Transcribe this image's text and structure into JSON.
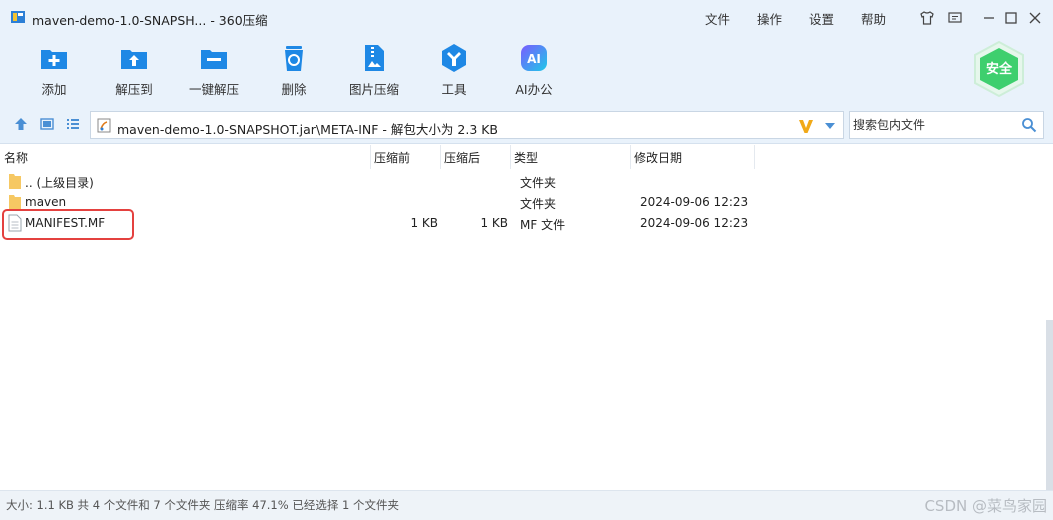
{
  "window": {
    "title": "maven-demo-1.0-SNAPSH... - 360压缩",
    "menus": [
      "文件",
      "操作",
      "设置",
      "帮助"
    ]
  },
  "toolbar": {
    "tools": [
      {
        "label": "添加",
        "icon": "add-icon"
      },
      {
        "label": "解压到",
        "icon": "extract-to-icon"
      },
      {
        "label": "一键解压",
        "icon": "one-click-extract-icon"
      },
      {
        "label": "删除",
        "icon": "delete-icon"
      },
      {
        "label": "图片压缩",
        "icon": "image-compress-icon"
      },
      {
        "label": "工具",
        "icon": "tools-icon"
      },
      {
        "label": "AI办公",
        "icon": "ai-office-icon"
      }
    ],
    "safe_badge": "安全"
  },
  "path": {
    "text": "maven-demo-1.0-SNAPSHOT.jar\\META-INF - 解包大小为 2.3 KB"
  },
  "search": {
    "placeholder": "搜索包内文件"
  },
  "columns": {
    "name": "名称",
    "compressed_before": "压缩前",
    "compressed_after": "压缩后",
    "type": "类型",
    "modified": "修改日期"
  },
  "files": [
    {
      "name": ".. (上级目录)",
      "before": "",
      "after": "",
      "type": "文件夹",
      "date": "",
      "icon": "folder-icon"
    },
    {
      "name": "maven",
      "before": "",
      "after": "",
      "type": "文件夹",
      "date": "2024-09-06 12:23",
      "icon": "folder-icon"
    },
    {
      "name": "MANIFEST.MF",
      "before": "1 KB",
      "after": "1 KB",
      "type": "MF 文件",
      "date": "2024-09-06 12:23",
      "icon": "file-icon"
    }
  ],
  "status": {
    "text": "大小: 1.1 KB 共 4 个文件和 7 个文件夹 压缩率 47.1% 已经选择 1 个文件夹",
    "watermark": "CSDN @菜鸟家园"
  },
  "colors": {
    "chrome_bg": "#e9f2fb",
    "icon_blue": "#1e88e5",
    "highlight_red": "#e4413f",
    "safe_green": "#3ecf6e"
  }
}
